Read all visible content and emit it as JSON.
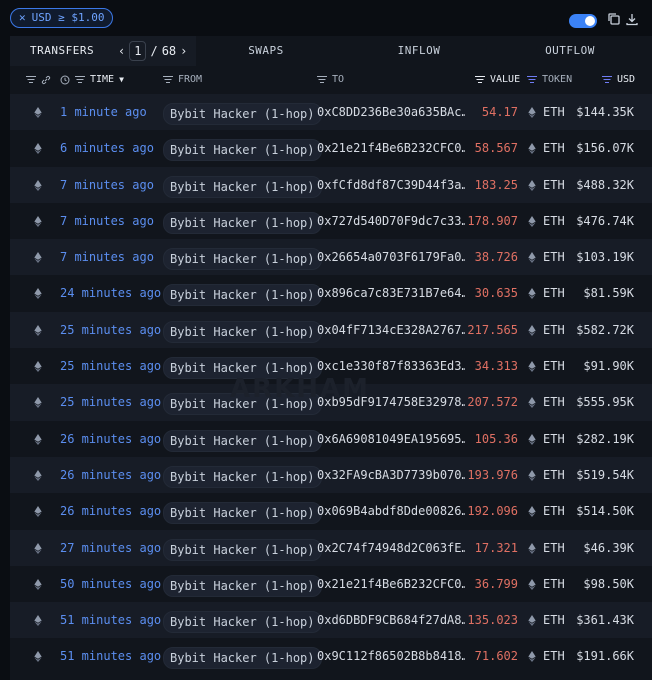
{
  "filter": {
    "label": "USD ≥ $1.00"
  },
  "tabs": [
    {
      "label": "TRANSFERS"
    },
    {
      "label": "SWAPS"
    },
    {
      "label": "INFLOW"
    },
    {
      "label": "OUTFLOW"
    }
  ],
  "pager": {
    "current": "1",
    "separator": "/",
    "total": "68"
  },
  "columns": {
    "time": "TIME",
    "from": "FROM",
    "to": "TO",
    "value": "VALUE",
    "token": "TOKEN",
    "usd": "USD"
  },
  "watermark": "ARKHAM",
  "rows": [
    {
      "time": "1 minute ago",
      "from": "Bybit Hacker (1-hop)",
      "to": "0xC8DD236Be30a635BAc…",
      "value": "54.17",
      "token": "ETH",
      "usd": "$144.35K"
    },
    {
      "time": "6 minutes ago",
      "from": "Bybit Hacker (1-hop)",
      "to": "0x21e21f4Be6B232CFC0…",
      "value": "58.567",
      "token": "ETH",
      "usd": "$156.07K"
    },
    {
      "time": "7 minutes ago",
      "from": "Bybit Hacker (1-hop)",
      "to": "0xfCfd8df87C39D44f3a…",
      "value": "183.25",
      "token": "ETH",
      "usd": "$488.32K"
    },
    {
      "time": "7 minutes ago",
      "from": "Bybit Hacker (1-hop)",
      "to": "0x727d540D70F9dc7c33…",
      "value": "178.907",
      "token": "ETH",
      "usd": "$476.74K"
    },
    {
      "time": "7 minutes ago",
      "from": "Bybit Hacker (1-hop)",
      "to": "0x26654a0703F6179Fa0…",
      "value": "38.726",
      "token": "ETH",
      "usd": "$103.19K"
    },
    {
      "time": "24 minutes ago",
      "from": "Bybit Hacker (1-hop)",
      "to": "0x896ca7c83E731B7e64…",
      "value": "30.635",
      "token": "ETH",
      "usd": "$81.59K"
    },
    {
      "time": "25 minutes ago",
      "from": "Bybit Hacker (1-hop)",
      "to": "0x04fF7134cE328A2767…",
      "value": "217.565",
      "token": "ETH",
      "usd": "$582.72K"
    },
    {
      "time": "25 minutes ago",
      "from": "Bybit Hacker (1-hop)",
      "to": "0xc1e330f87f83363Ed3…",
      "value": "34.313",
      "token": "ETH",
      "usd": "$91.90K"
    },
    {
      "time": "25 minutes ago",
      "from": "Bybit Hacker (1-hop)",
      "to": "0xb95dF9174758E32978…",
      "value": "207.572",
      "token": "ETH",
      "usd": "$555.95K"
    },
    {
      "time": "26 minutes ago",
      "from": "Bybit Hacker (1-hop)",
      "to": "0x6A69081049EA195695…",
      "value": "105.36",
      "token": "ETH",
      "usd": "$282.19K"
    },
    {
      "time": "26 minutes ago",
      "from": "Bybit Hacker (1-hop)",
      "to": "0x32FA9cBA3D7739b070…",
      "value": "193.976",
      "token": "ETH",
      "usd": "$519.54K"
    },
    {
      "time": "26 minutes ago",
      "from": "Bybit Hacker (1-hop)",
      "to": "0x069B4abdf8Dde00826…",
      "value": "192.096",
      "token": "ETH",
      "usd": "$514.50K"
    },
    {
      "time": "27 minutes ago",
      "from": "Bybit Hacker (1-hop)",
      "to": "0x2C74f74948d2C063fE…",
      "value": "17.321",
      "token": "ETH",
      "usd": "$46.39K"
    },
    {
      "time": "50 minutes ago",
      "from": "Bybit Hacker (1-hop)",
      "to": "0x21e21f4Be6B232CFC0…",
      "value": "36.799",
      "token": "ETH",
      "usd": "$98.50K"
    },
    {
      "time": "51 minutes ago",
      "from": "Bybit Hacker (1-hop)",
      "to": "0xd6DBDF9CB684f27dA8…",
      "value": "135.023",
      "token": "ETH",
      "usd": "$361.43K"
    },
    {
      "time": "51 minutes ago",
      "from": "Bybit Hacker (1-hop)",
      "to": "0x9C112f86502B8b8418…",
      "value": "71.602",
      "token": "ETH",
      "usd": "$191.66K"
    }
  ]
}
